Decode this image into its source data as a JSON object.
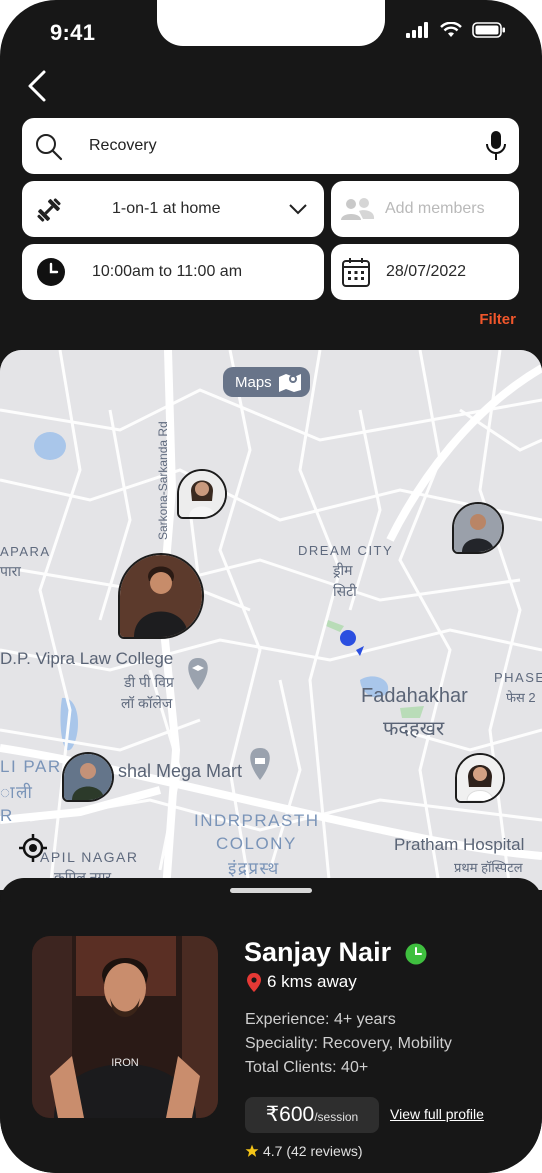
{
  "status": {
    "time": "9:41"
  },
  "search": {
    "value": "Recovery"
  },
  "session": {
    "type": "1-on-1 at home"
  },
  "members": {
    "placeholder": "Add members"
  },
  "schedule": {
    "time_range": "10:00am to 11:00 am",
    "date": "28/07/2022"
  },
  "filter_label": "Filter",
  "map": {
    "maps_button": "Maps",
    "labels": {
      "road": "Sarkona-Sarkanda Rd",
      "apara": "APARA",
      "apara_hi": "पारा",
      "dream_city": "DREAM CITY",
      "dream_city_hi_1": "ड्रीम",
      "dream_city_hi_2": "सिटी",
      "college": "D.P. Vipra Law College",
      "college_hi_1": "डी पी विप्र",
      "college_hi_2": "लॉ कॉलेज",
      "fadahakhar": "Fadahakhar",
      "fadahakhar_hi": "फदहखर",
      "phase": "PHASE",
      "phase_hi": "फेस 2",
      "li_par": "LI PAR",
      "li_par_hi": "ाली",
      "r": "R",
      "mart": "shal Mega Mart",
      "indrprasth": "INDRPRASTH",
      "colony": "COLONY",
      "indrprasth_hi": "इंद्रप्रस्थ",
      "pratham": "Pratham Hospital",
      "pratham_hi": "प्रथम हॉस्पिटल",
      "kapil": "APIL NAGAR",
      "kapil_hi": "कपिल नगर"
    }
  },
  "trainer": {
    "name": "Sanjay Nair",
    "distance": "6 kms away",
    "experience": "Experience: 4+ years",
    "speciality": "Speciality: Recovery, Mobility",
    "clients": "Total Clients: 40+",
    "price": "₹600",
    "price_unit": "/session",
    "profile_link": "View full profile",
    "rating": "4.7 (42 reviews)",
    "shirt_text": "IRON"
  },
  "colors": {
    "accent": "#f0562b",
    "online": "#3fbf3f",
    "location_pin": "#e53935",
    "star": "#f5c518"
  },
  "icons": [
    "back-icon",
    "search-icon",
    "mic-icon",
    "dumbbell-icon",
    "chevron-down-icon",
    "group-icon",
    "clock-icon",
    "calendar-icon",
    "map-icon",
    "target-icon",
    "location-pin-icon",
    "star-icon"
  ]
}
